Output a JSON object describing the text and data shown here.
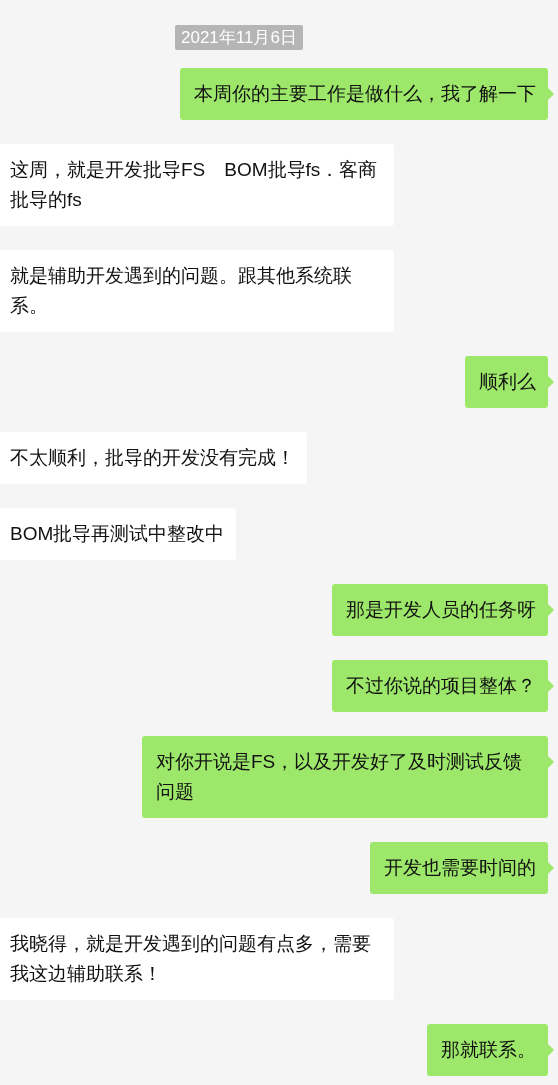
{
  "date_divider": "2021年11月6日",
  "messages": [
    {
      "kind": "sent",
      "text": "本周你的主要工作是做什么，我了解一下"
    },
    {
      "kind": "received",
      "text": "这周，就是开发批导FS　BOM批导fs．客商批导的fs"
    },
    {
      "kind": "received",
      "text": "就是辅助开发遇到的问题。跟其他系统联系。"
    },
    {
      "kind": "sent",
      "text": "顺利么"
    },
    {
      "kind": "received",
      "text": "不太顺利，批导的开发没有完成！"
    },
    {
      "kind": "received",
      "text": "BOM批导再测试中整改中"
    },
    {
      "kind": "sent",
      "text": "那是开发人员的任务呀"
    },
    {
      "kind": "sent",
      "text": "不过你说的项目整体？"
    },
    {
      "kind": "sent",
      "text": "对你开说是FS，以及开发好了及时测试反馈问题"
    },
    {
      "kind": "sent",
      "text": "开发也需要时间的"
    },
    {
      "kind": "received",
      "text": "我晓得，就是开发遇到的问题有点多，需要我这边辅助联系！"
    },
    {
      "kind": "sent",
      "text": "那就联系。"
    }
  ]
}
